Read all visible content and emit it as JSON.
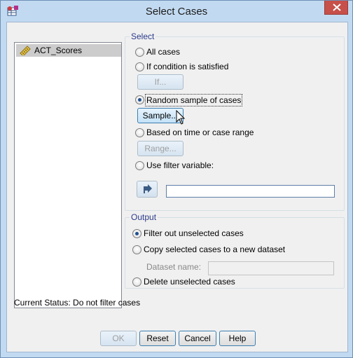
{
  "window": {
    "title": "Select Cases",
    "close_icon": "close-icon",
    "app_icon": "spss-data-icon"
  },
  "variables": {
    "items": [
      {
        "label": "ACT_Scores",
        "icon": "scale-ruler-icon"
      }
    ]
  },
  "select": {
    "legend": "Select",
    "options": {
      "all": "All cases",
      "condition": "If condition is satisfied",
      "random": "Random sample of cases",
      "time": "Based on time or case range",
      "filter": "Use filter variable:"
    },
    "selected": "random",
    "buttons": {
      "if": "If...",
      "sample": "Sample...",
      "range": "Range..."
    },
    "filter_value": ""
  },
  "output": {
    "legend": "Output",
    "options": {
      "filter_out": "Filter out unselected cases",
      "copy": "Copy selected cases to a new dataset",
      "delete": "Delete unselected cases"
    },
    "selected": "filter_out",
    "dataset_label": "Dataset name:",
    "dataset_value": ""
  },
  "status": {
    "text": "Current Status: Do not filter cases"
  },
  "buttons": {
    "ok": "OK",
    "reset": "Reset",
    "cancel": "Cancel",
    "help": "Help"
  }
}
